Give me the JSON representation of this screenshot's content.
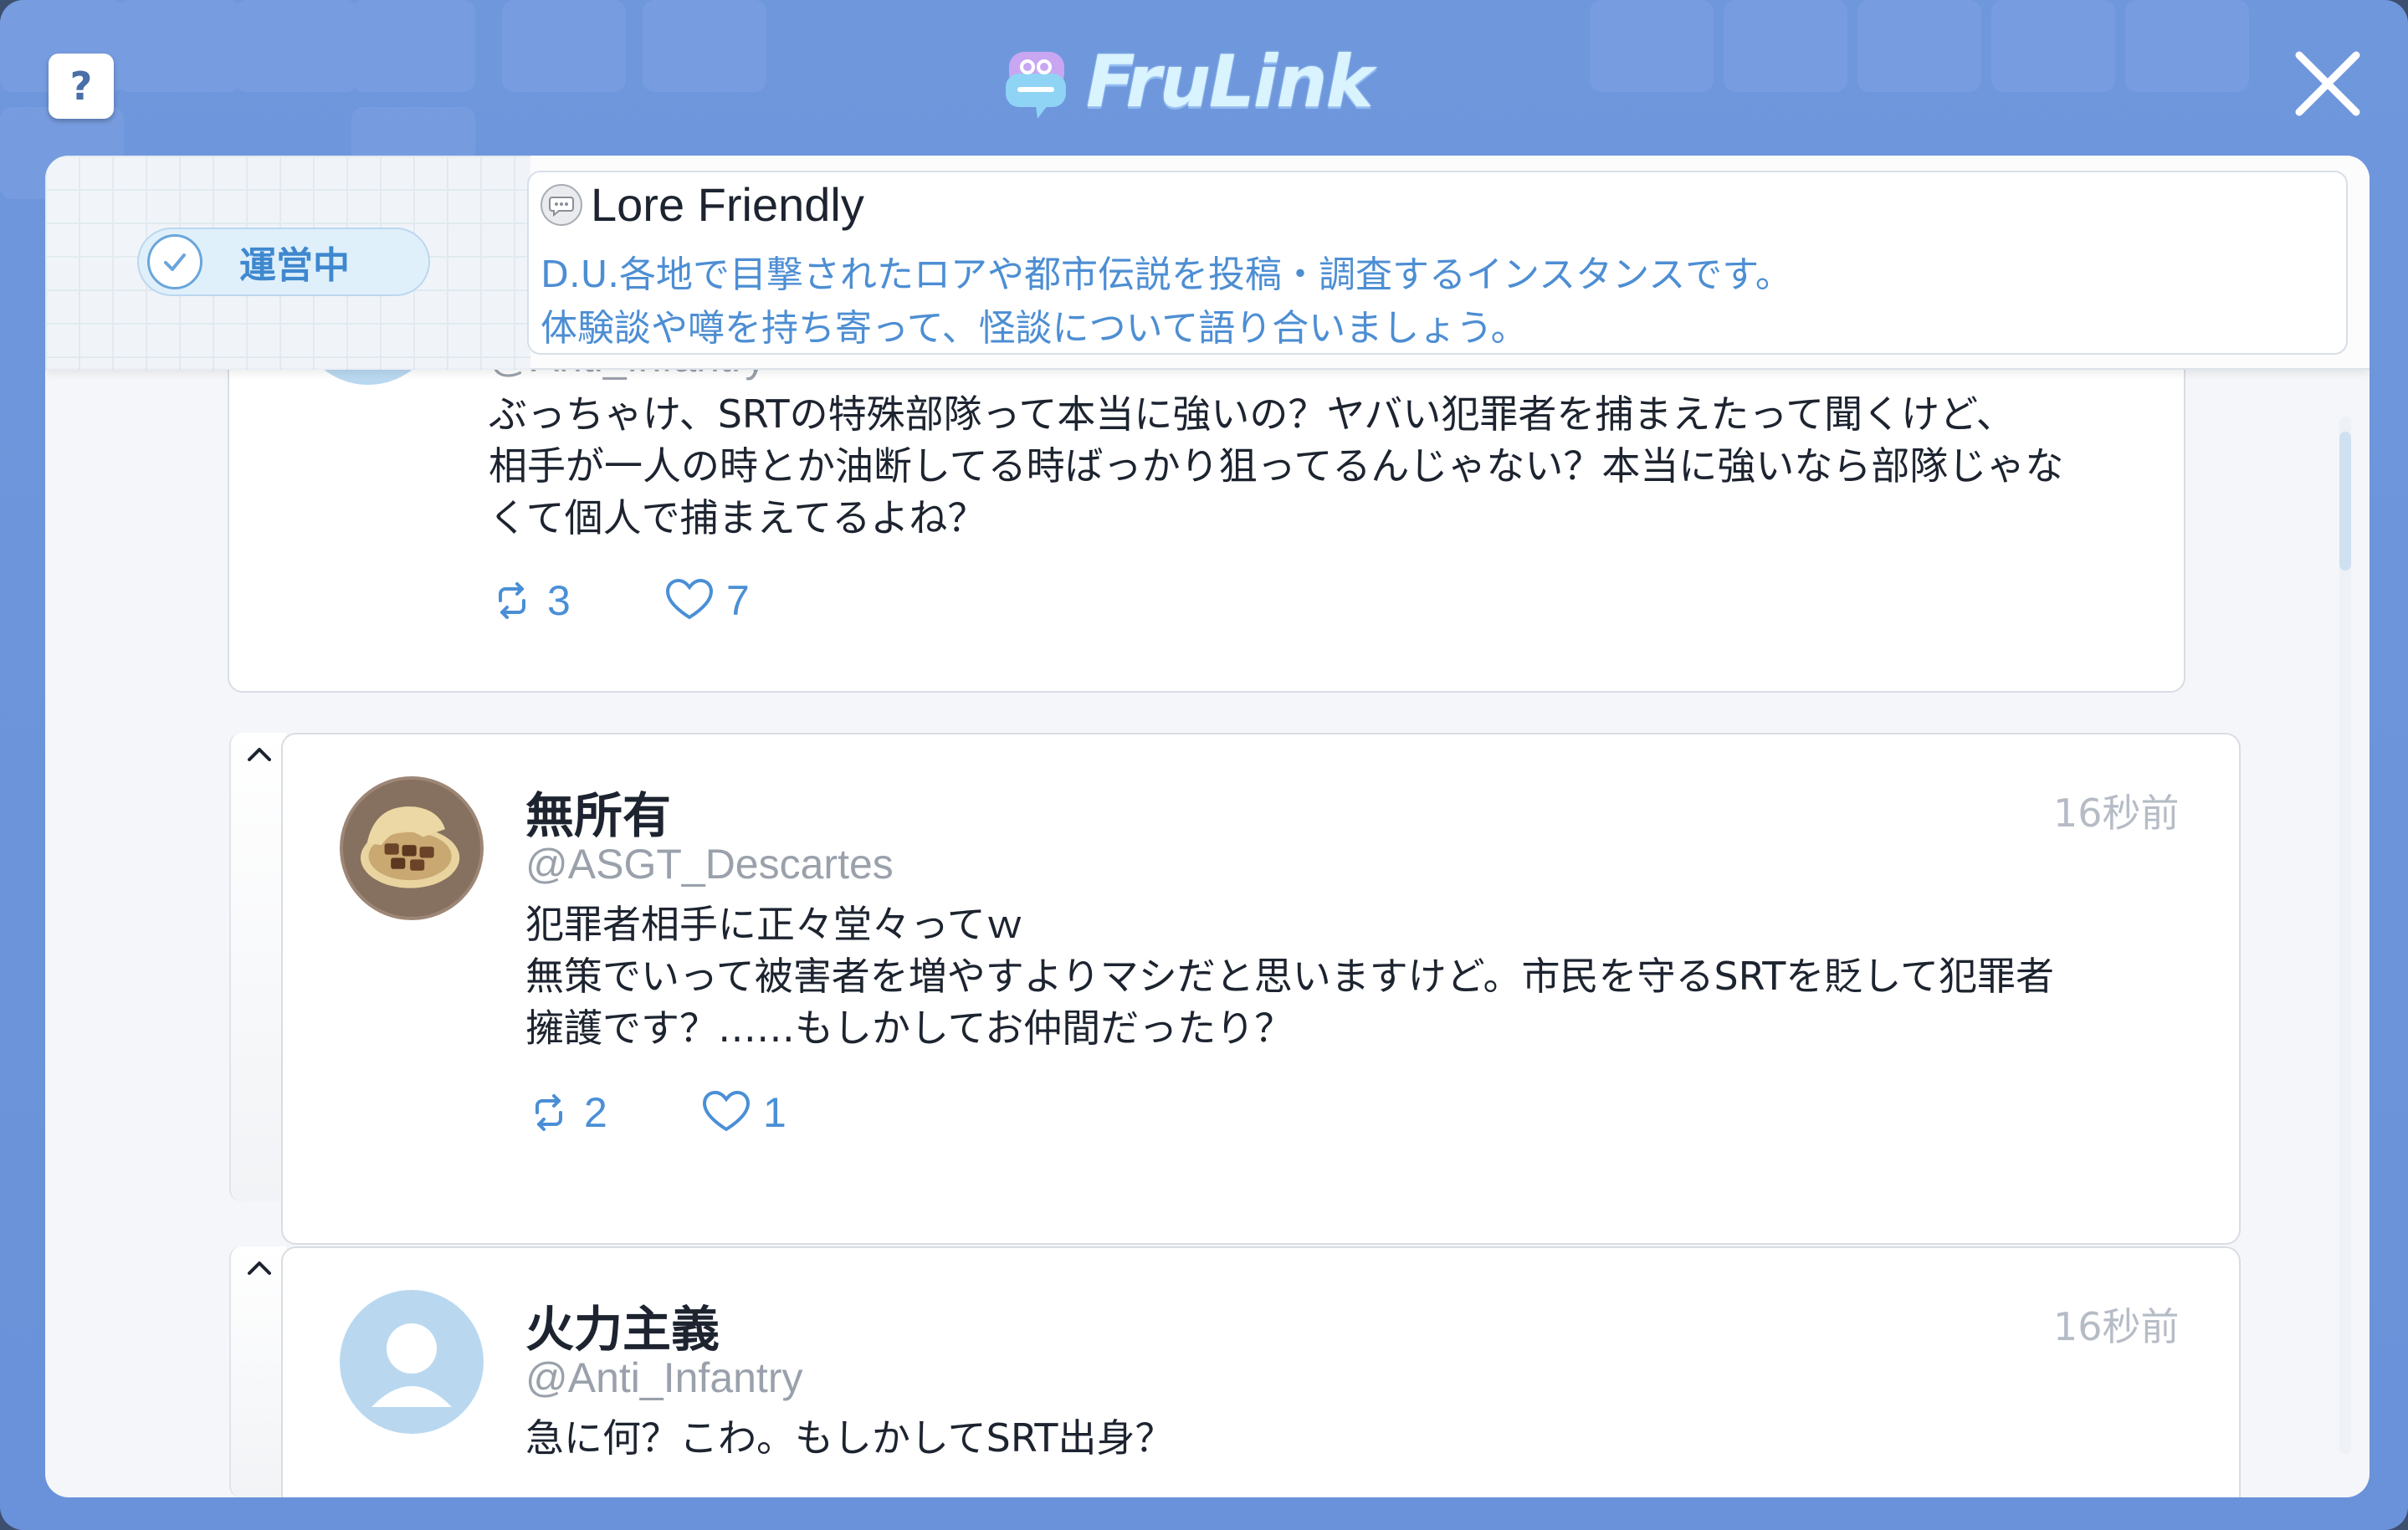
{
  "header": {
    "help_label": "?",
    "brand_name": "FruLink",
    "close_icon": "close-icon"
  },
  "banner": {
    "status_label": "運営中",
    "instance_title": "Lore Friendly",
    "description_line1": "D.U.各地で目撃されたロアや都市伝説を投稿・調査するインスタンスです。",
    "description_line2": "体験談や噂を持ち寄って、怪談について語り合いましょう。"
  },
  "posts": [
    {
      "handle": "@Anti_Infantry",
      "text_line1": "ぶっちゃけ、SRTの特殊部隊って本当に強いの？ヤバい犯罪者を捕まえたって聞くけど、",
      "text_line2": "相手が一人の時とか油断してる時ばっかり狙ってるんじゃない？本当に強いなら部隊じゃな",
      "text_line3": "くて個人で捕まえてるよね？",
      "reposts": "3",
      "likes": "7"
    },
    {
      "name": "無所有",
      "handle": "@ASGT_Descartes",
      "time": "16秒前",
      "text_line1": "犯罪者相手に正々堂々ってｗ",
      "text_line2": "無策でいって被害者を増やすよりマシだと思いますけど。市民を守るSRTを貶して犯罪者",
      "text_line3": "擁護です？……もしかしてお仲間だったり？",
      "reposts": "2",
      "likes": "1"
    },
    {
      "name": "火力主義",
      "handle": "@Anti_Infantry",
      "time": "16秒前",
      "text_line1": "急に何？こわ。もしかしてSRT出身？"
    }
  ],
  "colors": {
    "frame": "#6f97dc",
    "accent": "#4a8fd6",
    "status_bg": "#dff0fb"
  }
}
